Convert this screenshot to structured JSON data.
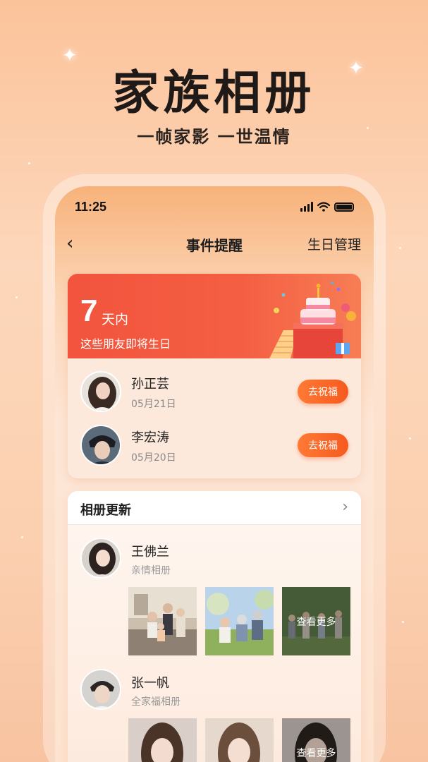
{
  "hero": {
    "title": "家族相册",
    "subtitle": "一帧家影  一世温情"
  },
  "statusbar": {
    "time": "11:25"
  },
  "nav": {
    "back": "‹",
    "title": "事件提醒",
    "right": "生日管理"
  },
  "birthday": {
    "count": "7",
    "count_unit": "天内",
    "description": "这些朋友即将生日",
    "friends": [
      {
        "name": "孙正芸",
        "date": "05月21日",
        "action": "去祝福"
      },
      {
        "name": "李宏涛",
        "date": "05月20日",
        "action": "去祝福"
      }
    ]
  },
  "album": {
    "title": "相册更新",
    "chevron": "›",
    "posts": [
      {
        "name": "王佛兰",
        "album": "亲情相册",
        "more": "查看更多"
      },
      {
        "name": "张一帆",
        "album": "全家福相册",
        "more": "查看更多"
      }
    ]
  },
  "colors": {
    "accent": "#f55a1f",
    "banner": "#f2543d",
    "background": "#fcd4b4"
  }
}
